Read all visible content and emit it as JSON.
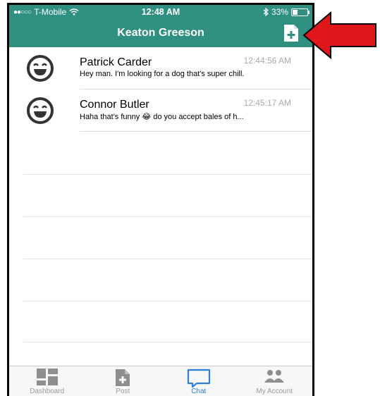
{
  "status_bar": {
    "carrier": "T-Mobile",
    "time": "12:48 AM",
    "battery": "33%"
  },
  "header": {
    "title": "Keaton Greeson"
  },
  "conversations": [
    {
      "name": "Patrick Carder",
      "time": "12:44:56 AM",
      "message": "Hey man. I'm looking for a dog that's super chill."
    },
    {
      "name": "Connor Butler",
      "time": "12:45:17 AM",
      "message": "Haha that's funny 😂 do you accept bales of h..."
    }
  ],
  "tabs": [
    {
      "label": "Dashboard",
      "icon": "dashboard-icon"
    },
    {
      "label": "Post",
      "icon": "post-icon"
    },
    {
      "label": "Chat",
      "icon": "chat-icon"
    },
    {
      "label": "My Account",
      "icon": "account-icon"
    }
  ],
  "colors": {
    "header": "#2f8f80",
    "active_tab": "#2f7fd8",
    "arrow": "#e0161b"
  }
}
